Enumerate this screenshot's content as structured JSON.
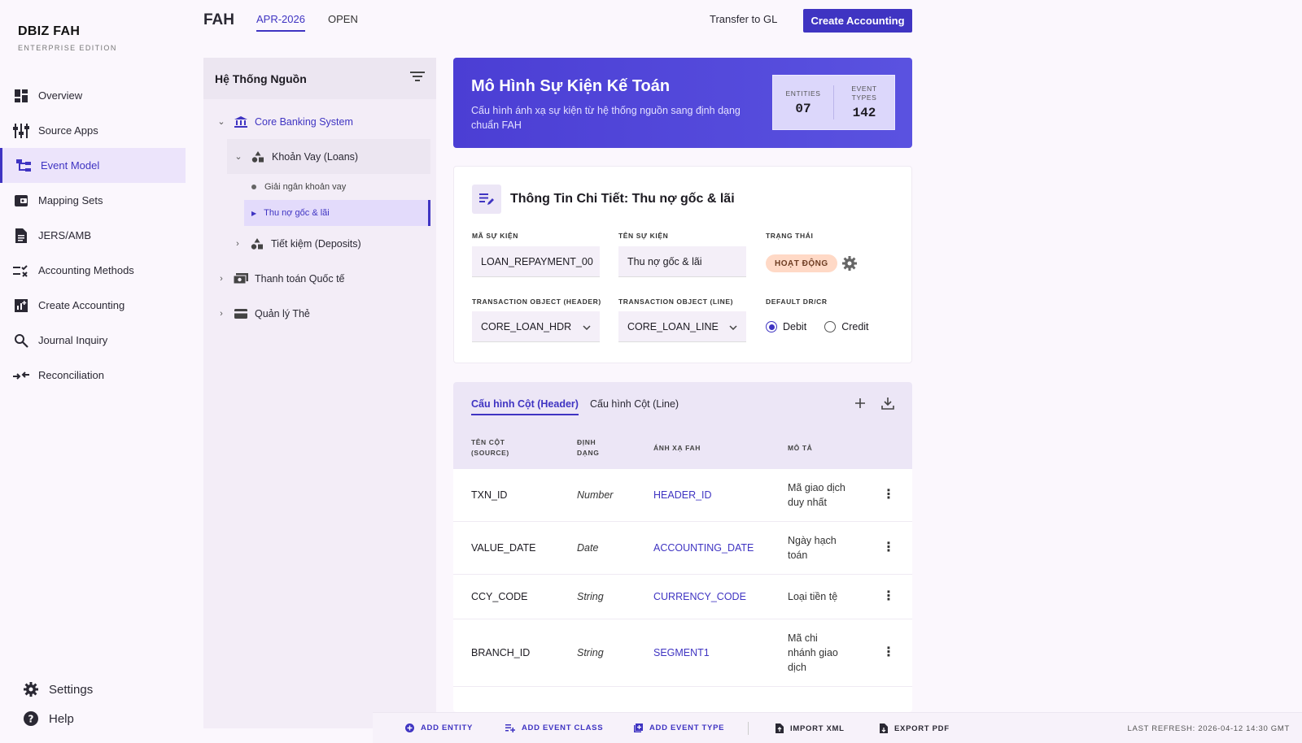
{
  "brand": {
    "title": "DBIZ FAH",
    "subtitle": "ENTERPRISE EDITION"
  },
  "nav": [
    {
      "label": "Overview",
      "icon": "dashboard-icon"
    },
    {
      "label": "Source Apps",
      "icon": "sliders-icon"
    },
    {
      "label": "Event Model",
      "icon": "hierarchy-icon",
      "active": true
    },
    {
      "label": "Mapping Sets",
      "icon": "wallet-icon"
    },
    {
      "label": "JERS/AMB",
      "icon": "document-icon"
    },
    {
      "label": "Accounting Methods",
      "icon": "rule-icon"
    },
    {
      "label": "Create Accounting",
      "icon": "chart-add-icon"
    },
    {
      "label": "Journal Inquiry",
      "icon": "search-icon"
    },
    {
      "label": "Reconciliation",
      "icon": "compare-arrows-icon"
    }
  ],
  "bottom_nav": {
    "settings": "Settings",
    "help": "Help"
  },
  "header": {
    "title": "FAH",
    "period": "APR-2026",
    "status": "OPEN",
    "transfer_label": "Transfer to GL",
    "create_label": "Create Accounting"
  },
  "tree": {
    "title": "Hệ Thống Nguồn",
    "core": "Core Banking System",
    "loans": "Khoản Vay (Loans)",
    "leaf1": "Giải ngân khoản vay",
    "leaf2": "Thu nợ gốc & lãi",
    "deposits": "Tiết kiệm (Deposits)",
    "intl": "Thanh toán Quốc tế",
    "cards": "Quản lý Thẻ"
  },
  "hero": {
    "title": "Mô Hình Sự Kiện Kế Toán",
    "description": "Cấu hình ánh xạ sự kiện từ hệ thống nguồn sang định dạng chuẩn FAH",
    "entities_label": "ENTITIES",
    "entities_value": "07",
    "event_types_label": "EVENT TYPES",
    "event_types_value": "142"
  },
  "detail": {
    "title": "Thông Tin Chi Tiết: Thu nợ gốc & lãi",
    "code_label": "MÃ SỰ KIỆN",
    "code_value": "LOAN_REPAYMENT_00",
    "name_label": "TÊN SỰ KIỆN",
    "name_value": "Thu nợ gốc & lãi",
    "status_label": "TRẠNG THÁI",
    "status_value": "HOẠT ĐỘNG",
    "txn_header_label": "TRANSACTION OBJECT (HEADER)",
    "txn_header_value": "CORE_LOAN_HDR",
    "txn_line_label": "TRANSACTION OBJECT (LINE)",
    "txn_line_value": "CORE_LOAN_LINE",
    "drcr_label": "DEFAULT DR/CR",
    "debit_label": "Debit",
    "credit_label": "Credit"
  },
  "columns": {
    "tab_header": "Cấu hình Cột (Header)",
    "tab_line": "Cấu hình Cột (Line)",
    "th_source": "TÊN CỘT (SOURCE)",
    "th_format": "ĐỊNH DẠNG",
    "th_map": "ÁNH XẠ FAH",
    "th_desc": "MÔ TẢ",
    "rows": [
      {
        "source": "TXN_ID",
        "format": "Number",
        "map": "HEADER_ID",
        "desc": "Mã giao dịch duy nhất"
      },
      {
        "source": "VALUE_DATE",
        "format": "Date",
        "map": "ACCOUNTING_DATE",
        "desc": "Ngày hạch toán"
      },
      {
        "source": "CCY_CODE",
        "format": "String",
        "map": "CURRENCY_CODE",
        "desc": "Loại tiền tệ"
      },
      {
        "source": "BRANCH_ID",
        "format": "String",
        "map": "SEGMENT1",
        "desc": "Mã chi nhánh giao dịch"
      }
    ]
  },
  "actions": {
    "add_entity": "ADD ENTITY",
    "add_event_class": "ADD EVENT CLASS",
    "add_event_type": "ADD EVENT TYPE",
    "import_xml": "IMPORT XML",
    "export_pdf": "EXPORT PDF",
    "last_refresh": "LAST REFRESH: 2026-04-12 14:30 GMT"
  },
  "colors": {
    "primary": "#3f34c2",
    "hero_start": "#4b3ed4",
    "badge_bg": "#ffd9c6"
  }
}
